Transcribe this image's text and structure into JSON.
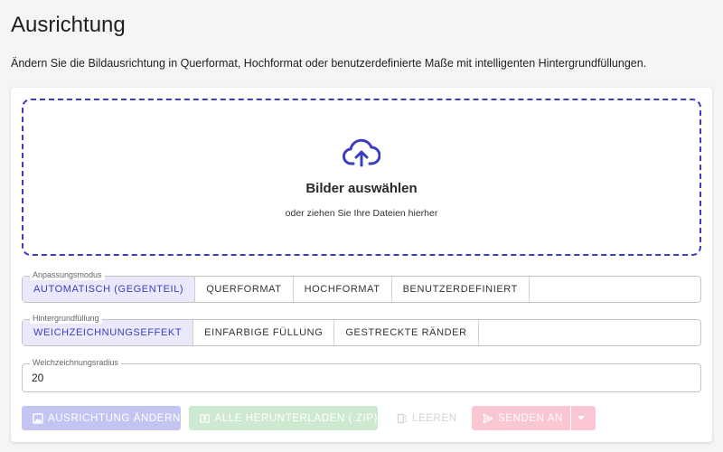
{
  "page": {
    "title": "Ausrichtung",
    "description": "Ändern Sie die Bildausrichtung in Querformat, Hochformat oder benutzerdefinierte Maße mit intelligenten Hintergrundfüllungen."
  },
  "dropzone": {
    "title": "Bilder auswählen",
    "subtitle": "oder ziehen Sie Ihre Dateien hierher",
    "icon": "cloud-upload-icon"
  },
  "fit_mode": {
    "label": "Anpassungsmodus",
    "options": [
      "AUTOMATISCH (GEGENTEIL)",
      "QUERFORMAT",
      "HOCHFORMAT",
      "BENUTZERDEFINIERT"
    ],
    "selected": "AUTOMATISCH (GEGENTEIL)"
  },
  "background_fill": {
    "label": "Hintergrundfüllung",
    "options": [
      "WEICHZEICHNUNGSEFFEKT",
      "EINFARBIGE FÜLLUNG",
      "GESTRECKTE RÄNDER"
    ],
    "selected": "WEICHZEICHNUNGSEFFEKT"
  },
  "blur_radius": {
    "label": "Weichzeichnungsradius",
    "value": "20"
  },
  "actions": {
    "rotate": "AUSRICHTUNG ÄNDERN",
    "download_all": "ALLE HERUNTERLADEN (.ZIP)",
    "clear": "LEEREN",
    "send_to": "SENDEN AN"
  },
  "colors": {
    "accent": "#3b3ec4",
    "active_segment_bg": "#e9e9fb"
  }
}
